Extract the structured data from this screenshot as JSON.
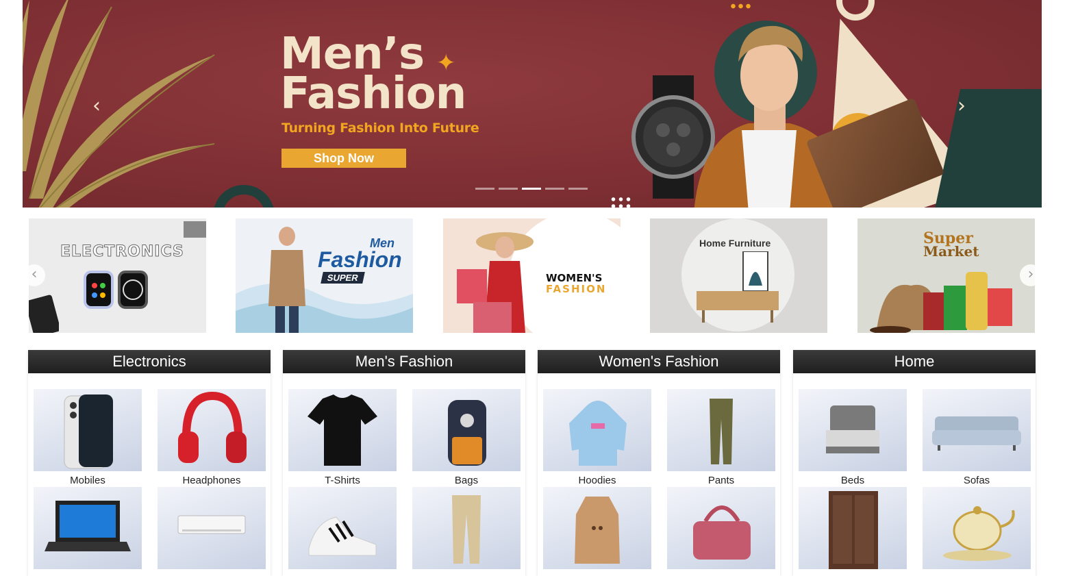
{
  "hero": {
    "title_line1": "Men’s",
    "title_line2": "Fashion",
    "subtitle": "Turning Fashion Into Future",
    "cta_label": "Shop Now",
    "prev_icon": "chevron-left-icon",
    "next_icon": "chevron-right-icon",
    "indicator_count": 5,
    "active_indicator": 3
  },
  "banners": [
    {
      "text": "ELECTRONICS"
    },
    {
      "text_top": "Men",
      "text_main": "Fashion",
      "badge": "SUPER"
    },
    {
      "text_top": "WOMEN'S",
      "text_main": "FASHION"
    },
    {
      "text": "Home Furniture"
    },
    {
      "text_top": "Super",
      "text_main": "Market"
    }
  ],
  "cards": [
    {
      "title": "Electronics",
      "items": [
        "Mobiles",
        "Headphones"
      ]
    },
    {
      "title": "Men's Fashion",
      "items": [
        "T-Shirts",
        "Bags"
      ]
    },
    {
      "title": "Women's Fashion",
      "items": [
        "Hoodies",
        "Pants"
      ]
    },
    {
      "title": "Home",
      "items": [
        "Beds",
        "Sofas"
      ]
    }
  ],
  "colors": {
    "hero_bg": "#7e2f33",
    "accent": "#e9a731",
    "cream": "#f3e3c9",
    "card_header": "#262626"
  }
}
